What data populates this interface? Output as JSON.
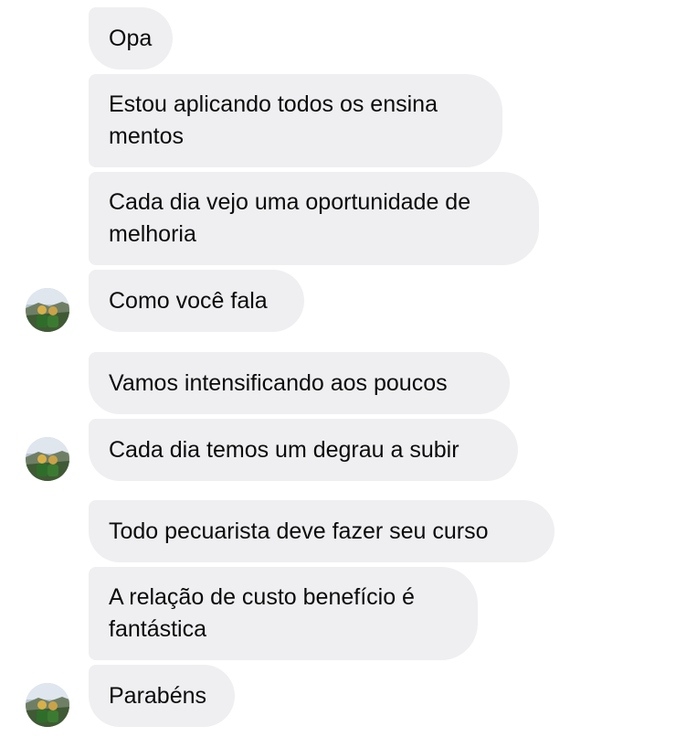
{
  "messages": [
    {
      "text": "Opa"
    },
    {
      "text": "Estou aplicando todos os ensina\nmentos"
    },
    {
      "text": "Cada dia vejo uma oportunidade de\nmelhoria"
    },
    {
      "text": "Como você fala"
    },
    {
      "text": "Vamos intensificando aos poucos"
    },
    {
      "text": "Cada dia temos um degrau a subir"
    },
    {
      "text": "Todo pecuarista deve fazer seu curso"
    },
    {
      "text": "A relação de custo benefício é\nfantástica"
    },
    {
      "text": "Parabéns"
    }
  ],
  "colors": {
    "bubble_background": "#efeff1",
    "text": "#0b0b0c",
    "page_background": "#ffffff"
  },
  "icons": {
    "avatar": "sender-avatar-photo"
  }
}
